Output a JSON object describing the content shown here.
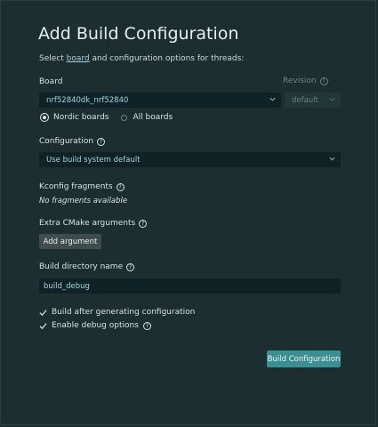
{
  "title": "Add Build Configuration",
  "subtitle": {
    "prefix": "Select ",
    "link": "board",
    "suffix": " and configuration options for threads:"
  },
  "board": {
    "label": "Board",
    "value": "nrf52840dk_nrf52840",
    "revision_label": "Revision",
    "revision_value": "default",
    "radio_nordic": "Nordic boards",
    "radio_all": "All boards",
    "selected_radio": "Nordic boards"
  },
  "configuration": {
    "label": "Configuration",
    "value": "Use build system default"
  },
  "kconfig": {
    "label": "Kconfig fragments",
    "empty_text": "No fragments available"
  },
  "cmake": {
    "label": "Extra CMake arguments",
    "button": "Add argument"
  },
  "build_dir": {
    "label": "Build directory name",
    "value": "build_debug"
  },
  "options": {
    "after_generating": "Build after generating configuration",
    "after_generating_checked": true,
    "debug": "Enable debug options",
    "debug_checked": true
  },
  "submit_button": "Build Configuration",
  "colors": {
    "accent": "#3e8d91",
    "background": "#1c2e30",
    "field": "#0f2326",
    "field_text": "#9fd4e0"
  }
}
